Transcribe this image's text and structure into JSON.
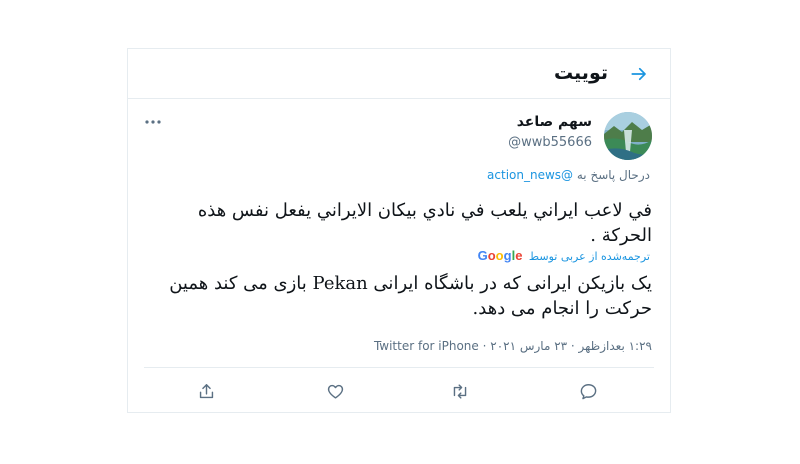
{
  "header": {
    "title": "توییت",
    "back_icon": "arrow-icon"
  },
  "author": {
    "name": "سهم صاعد",
    "handle": "@wwb55666",
    "avatar": "landscape-avatar"
  },
  "reply": {
    "prefix": "درحال پاسخ به ",
    "mention": "@action_news"
  },
  "tweet": {
    "text": "في لاعب ايراني يلعب في نادي بيكان الايراني يفعل نفس هذه الحركة ."
  },
  "translation": {
    "label": "ترجمه‌شده از عربی توسط",
    "provider": "Google",
    "text": "یک بازیکن ایرانی که در باشگاه ایرانی Pekan بازی می کند همین حرکت را انجام می دهد."
  },
  "meta": {
    "time": "۱:۲۹ بعدازظهر",
    "separator": " · ",
    "date": "۲۳ مارس ۲۰۲۱",
    "source": "Twitter for iPhone"
  },
  "actions": [
    "reply-icon",
    "retweet-icon",
    "like-icon",
    "share-icon"
  ],
  "colors": {
    "accent": "#1b95e0",
    "secondary_text": "#5b7083",
    "border": "#e6ecf0"
  }
}
